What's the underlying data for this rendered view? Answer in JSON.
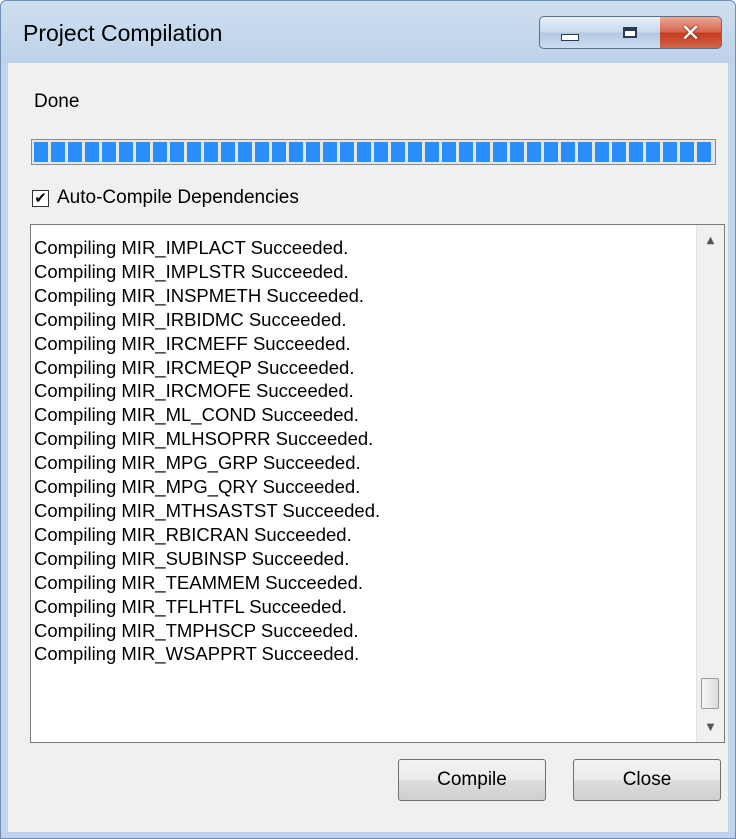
{
  "window": {
    "title": "Project Compilation",
    "controls": {
      "minimize": "minimize-icon",
      "maximize": "maximize-icon",
      "close": "close-icon"
    }
  },
  "status": {
    "text": "Done"
  },
  "progress": {
    "percent": 100,
    "color": "#2a8dfd"
  },
  "auto_compile": {
    "label": "Auto-Compile Dependencies",
    "checked": true
  },
  "log": {
    "lines": [
      "Compiling MIR_IMPLACT Succeeded.",
      "Compiling MIR_IMPLSTR Succeeded.",
      "Compiling MIR_INSPMETH Succeeded.",
      "Compiling MIR_IRBIDMC Succeeded.",
      "Compiling MIR_IRCMEFF Succeeded.",
      "Compiling MIR_IRCMEQP Succeeded.",
      "Compiling MIR_IRCMOFE Succeeded.",
      "Compiling MIR_ML_COND Succeeded.",
      "Compiling MIR_MLHSOPRR Succeeded.",
      "Compiling MIR_MPG_GRP Succeeded.",
      "Compiling MIR_MPG_QRY Succeeded.",
      "Compiling MIR_MTHSASTST Succeeded.",
      "Compiling MIR_RBICRAN Succeeded.",
      "Compiling MIR_SUBINSP Succeeded.",
      "Compiling MIR_TEAMMEM Succeeded.",
      "Compiling MIR_TFLHTFL Succeeded.",
      "Compiling MIR_TMPHSCP Succeeded.",
      "Compiling MIR_WSAPPRT Succeeded."
    ],
    "scroll_position": "bottom"
  },
  "buttons": {
    "compile": "Compile",
    "close": "Close"
  }
}
